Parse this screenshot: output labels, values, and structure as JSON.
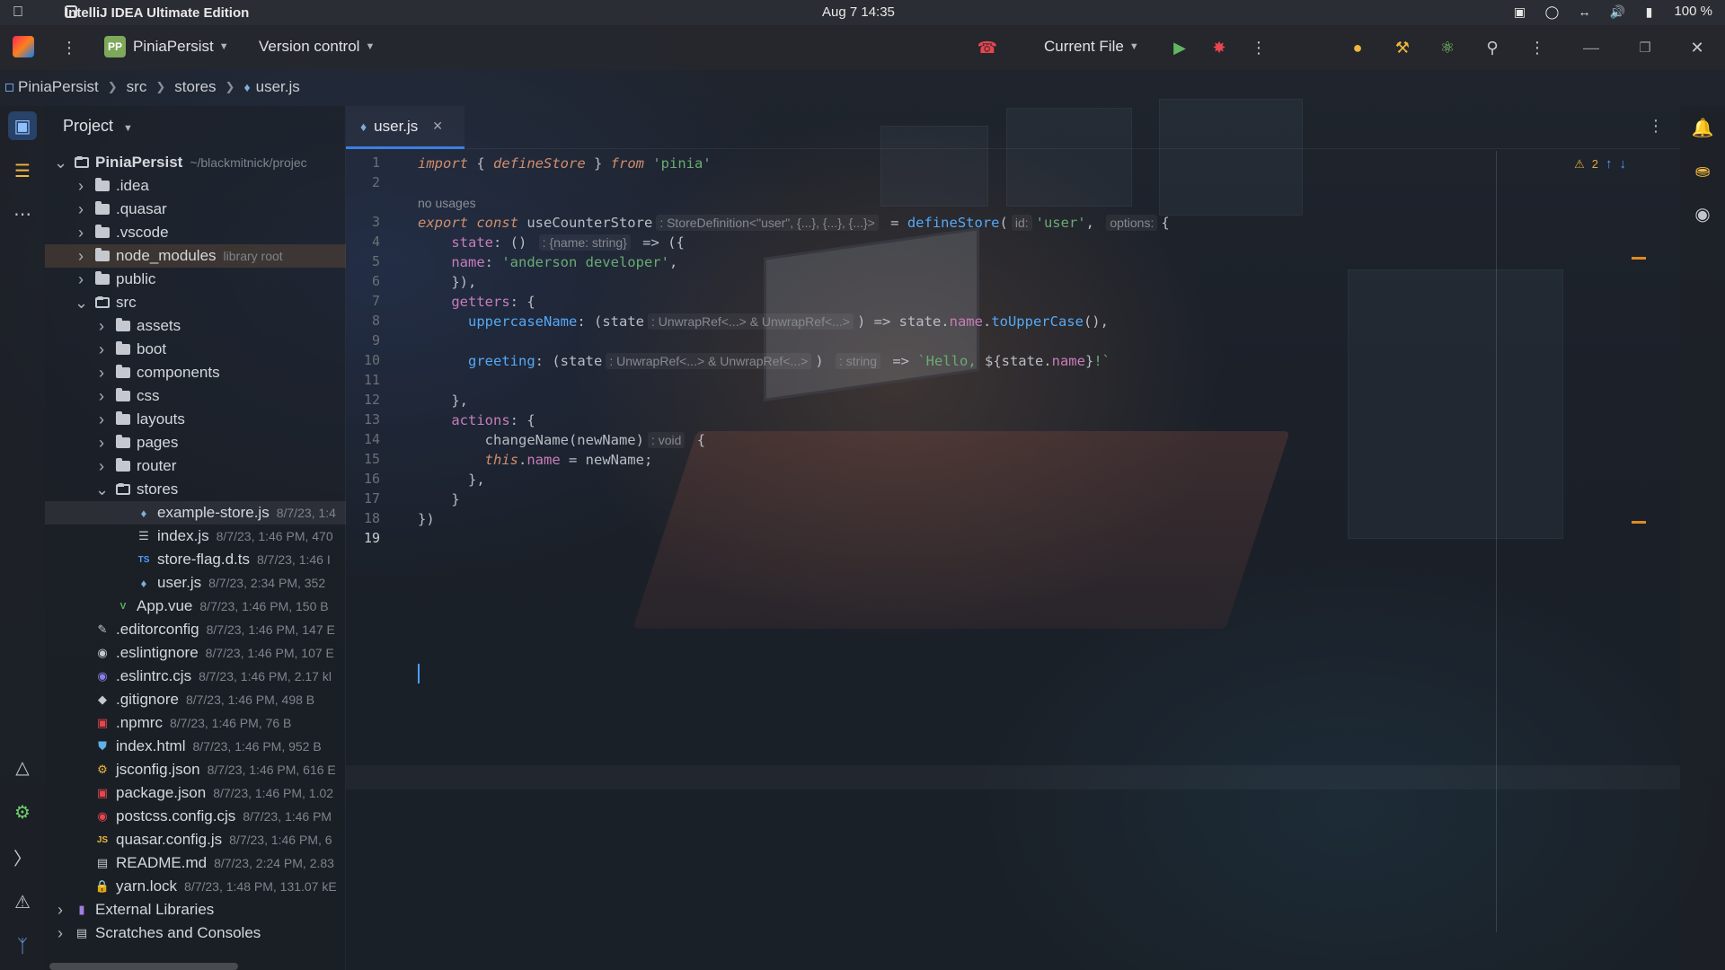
{
  "menubar": {
    "app_title": "IntelliJ IDEA Ultimate Edition",
    "clock": "Aug 7  14:35",
    "battery": "100 %"
  },
  "toolbar": {
    "project_name": "PiniaPersist",
    "project_badge": "PP",
    "vcs_label": "Version control",
    "run_config": "Current File"
  },
  "breadcrumb": [
    "PiniaPersist",
    "src",
    "stores",
    "user.js"
  ],
  "project_panel": {
    "header": "Project",
    "tree": [
      {
        "name": "PiniaPersist",
        "meta": "~/blackmitnick/projec",
        "kind": "root",
        "depth": 0,
        "open": true
      },
      {
        "name": ".idea",
        "meta": "",
        "kind": "folder",
        "depth": 1
      },
      {
        "name": ".quasar",
        "meta": "",
        "kind": "folder",
        "depth": 1
      },
      {
        "name": ".vscode",
        "meta": "",
        "kind": "folder",
        "depth": 1
      },
      {
        "name": "node_modules",
        "meta": "library root",
        "kind": "folder",
        "depth": 1,
        "highlight": true
      },
      {
        "name": "public",
        "meta": "",
        "kind": "folder",
        "depth": 1
      },
      {
        "name": "src",
        "meta": "",
        "kind": "folder",
        "depth": 1,
        "open": true
      },
      {
        "name": "assets",
        "meta": "",
        "kind": "folder",
        "depth": 2
      },
      {
        "name": "boot",
        "meta": "",
        "kind": "folder",
        "depth": 2
      },
      {
        "name": "components",
        "meta": "",
        "kind": "folder",
        "depth": 2
      },
      {
        "name": "css",
        "meta": "",
        "kind": "folder",
        "depth": 2
      },
      {
        "name": "layouts",
        "meta": "",
        "kind": "folder",
        "depth": 2
      },
      {
        "name": "pages",
        "meta": "",
        "kind": "folder",
        "depth": 2
      },
      {
        "name": "router",
        "meta": "",
        "kind": "folder",
        "depth": 2
      },
      {
        "name": "stores",
        "meta": "",
        "kind": "folder",
        "depth": 2,
        "open": true
      },
      {
        "name": "example-store.js",
        "meta": "8/7/23, 1:4",
        "kind": "file-pinia",
        "depth": 3,
        "selected": true
      },
      {
        "name": "index.js",
        "meta": "8/7/23, 1:46 PM, 470",
        "kind": "file-list",
        "depth": 3
      },
      {
        "name": "store-flag.d.ts",
        "meta": "8/7/23, 1:46 I",
        "kind": "file-ts",
        "depth": 3
      },
      {
        "name": "user.js",
        "meta": "8/7/23, 2:34 PM, 352",
        "kind": "file-pinia",
        "depth": 3
      },
      {
        "name": "App.vue",
        "meta": "8/7/23, 1:46 PM, 150 B",
        "kind": "file-vue",
        "depth": 2
      },
      {
        "name": ".editorconfig",
        "meta": "8/7/23, 1:46 PM, 147 E",
        "kind": "file-config",
        "depth": 1
      },
      {
        "name": ".eslintignore",
        "meta": "8/7/23, 1:46 PM, 107 E",
        "kind": "file-ignore",
        "depth": 1
      },
      {
        "name": ".eslintrc.cjs",
        "meta": "8/7/23, 1:46 PM, 2.17 kl",
        "kind": "file-eslint",
        "depth": 1
      },
      {
        "name": ".gitignore",
        "meta": "8/7/23, 1:46 PM, 498 B",
        "kind": "file-git",
        "depth": 1
      },
      {
        "name": ".npmrc",
        "meta": "8/7/23, 1:46 PM, 76 B",
        "kind": "file-npm",
        "depth": 1
      },
      {
        "name": "index.html",
        "meta": "8/7/23, 1:46 PM, 952 B",
        "kind": "file-html",
        "depth": 1
      },
      {
        "name": "jsconfig.json",
        "meta": "8/7/23, 1:46 PM, 616 E",
        "kind": "file-json",
        "depth": 1
      },
      {
        "name": "package.json",
        "meta": "8/7/23, 1:46 PM, 1.02",
        "kind": "file-npm",
        "depth": 1
      },
      {
        "name": "postcss.config.cjs",
        "meta": "8/7/23, 1:46 PM",
        "kind": "file-postcss",
        "depth": 1
      },
      {
        "name": "quasar.config.js",
        "meta": "8/7/23, 1:46 PM, 6",
        "kind": "file-js",
        "depth": 1
      },
      {
        "name": "README.md",
        "meta": "8/7/23, 2:24 PM, 2.83",
        "kind": "file-md",
        "depth": 1
      },
      {
        "name": "yarn.lock",
        "meta": "8/7/23, 1:48 PM, 131.07 kE",
        "kind": "file-lock",
        "depth": 1
      },
      {
        "name": "External Libraries",
        "meta": "",
        "kind": "ext",
        "depth": 0
      },
      {
        "name": "Scratches and Consoles",
        "meta": "",
        "kind": "scratch",
        "depth": 0
      }
    ]
  },
  "editor": {
    "tab_label": "user.js",
    "warnings": "2",
    "line_numbers": [
      "1",
      "2",
      "3",
      "4",
      "5",
      "6",
      "7",
      "8",
      "9",
      "10",
      "11",
      "12",
      "13",
      "14",
      "15",
      "16",
      "17",
      "18",
      "19"
    ],
    "current_line": 19,
    "usages_hint": "no usages"
  },
  "colors": {
    "accent": "#3d7fe0",
    "keyword": "#cf8e6d",
    "function": "#56a8f5",
    "string": "#6aab73",
    "property": "#c77dbb",
    "warning": "#e2a844"
  }
}
